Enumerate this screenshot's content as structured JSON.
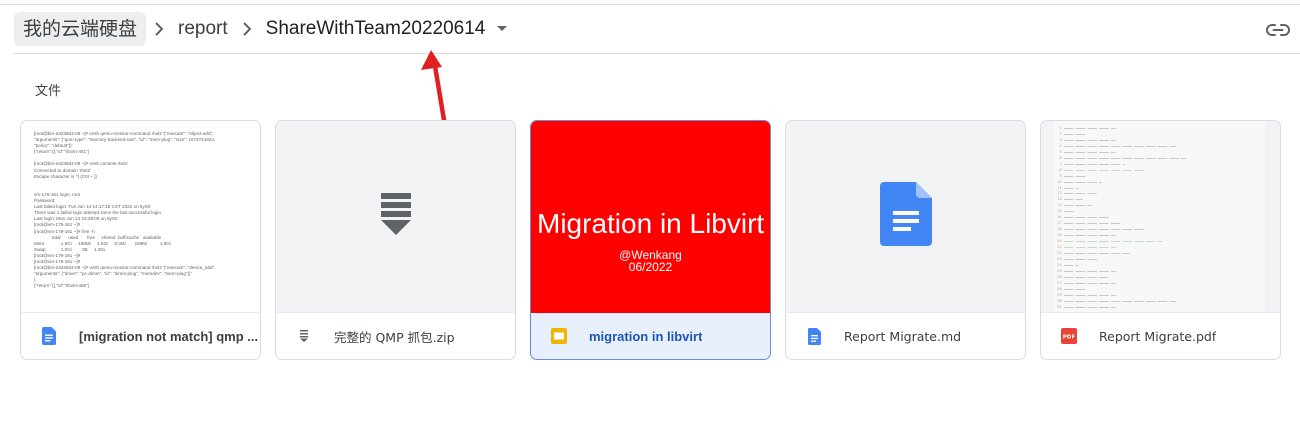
{
  "breadcrumb": {
    "root": "我的云端硬盘",
    "items": [
      "report",
      "ShareWithTeam20220614"
    ]
  },
  "section_label": "文件",
  "files": [
    {
      "name": "[migration not match] qmp ...",
      "icon": "google-docs-icon",
      "thumb_lines": [
        "[root@bm-e3238d4-08 ~]# virsh qemu-monitor-command rhel2 '{\"execute\": \"object-add\",",
        "\"arguments\": {\"qom-type\": \"memory-backend-ram\", \"id\": \"mem-plug\", \"size\": 1073741824,",
        "\"policy\": \"default\"}}'",
        "{\"return\":{},\"id\":\"libvirt-461\"}",
        "",
        "[root@bm-e3238d4-08 ~]# virsh console rhel2",
        "Connected to domain 'rhel2'",
        "Escape character is ^] (Ctrl + ])",
        "",
        "",
        "vm-179-161 login: root",
        "Password:",
        "Last failed login: Tue Jun 14 14:17:18 CST 2022 on ttyS0",
        "There was 1 failed login attempt since the last successful login.",
        "Last login: Mon Jun 13 23:38:08 on ttyS0",
        "[root@vm-179-161 ~]#",
        "[root@vm-179-161 ~]# free -h",
        "              total      used       free     shared  buff/cache   available",
        "Mem:            1.9Gi     168Mi     1.5Gi     8.0Mi       169Mi          1.6Gi",
        "Swap:           1.0Gi        0B     1.0Gi",
        "[root@vm-179-161 ~]#",
        "[root@vm-179-161 ~]#",
        "[root@bm-e3238d4-08 ~]# virsh qemu-monitor-command rhel2 '{\"execute\": \"device_add\",",
        "\"arguments\": {\"driver\": \"pc-dimm\", \"id\": \"dimm-plug\", \"memdev\": \"mem-plug\"}}'",
        "{",
        "{\"return\":{},\"id\":\"libvirt-466\"}"
      ]
    },
    {
      "name": "完整的 QMP 抓包.zip",
      "icon": "zip-icon"
    },
    {
      "name": "migration in libvirt",
      "icon": "google-slides-icon",
      "slide_title": "Migration in Libvirt",
      "slide_author": "@Wenkang",
      "slide_date": "06/2022",
      "selected": true
    },
    {
      "name": "Report Migrate.md",
      "icon": "google-docs-icon"
    },
    {
      "name": "Report Migrate.pdf",
      "icon": "pdf-icon",
      "pdf_badge": "PDF"
    }
  ],
  "colors": {
    "accent": "#1a73e8",
    "slide_bg": "#fe0000",
    "annotation_arrow": "#e02020"
  }
}
